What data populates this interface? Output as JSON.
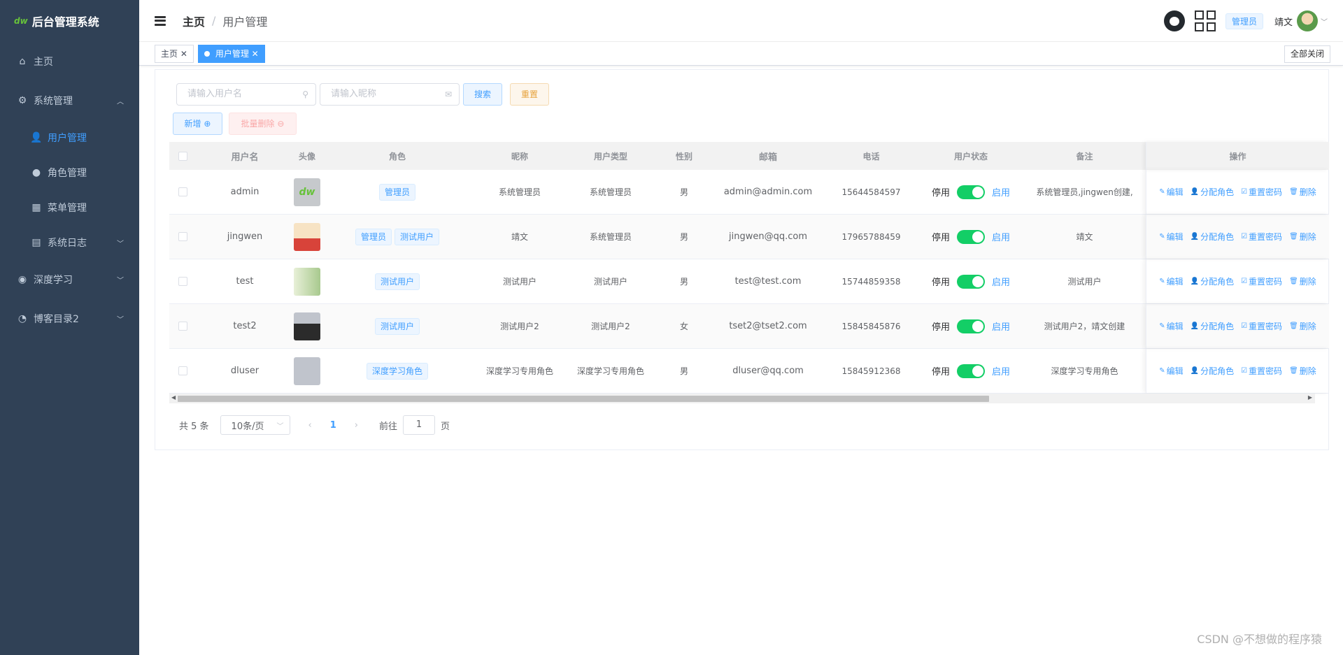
{
  "app": {
    "logo_mark": "dw",
    "title": "后台管理系统"
  },
  "sidebar": {
    "items": [
      {
        "label": "主页"
      },
      {
        "label": "系统管理"
      },
      {
        "label": "用户管理"
      },
      {
        "label": "角色管理"
      },
      {
        "label": "菜单管理"
      },
      {
        "label": "系统日志"
      },
      {
        "label": "深度学习"
      },
      {
        "label": "博客目录2"
      }
    ]
  },
  "header": {
    "breadcrumb": {
      "home": "主页",
      "sep": "/",
      "current": "用户管理"
    },
    "role": "管理员",
    "user": "靖文"
  },
  "tags": {
    "items": [
      {
        "label": "主页"
      },
      {
        "label": "用户管理"
      }
    ],
    "close_all": "全部关闭"
  },
  "search": {
    "username_placeholder": "请输入用户名",
    "nickname_placeholder": "请输入昵称",
    "search_label": "搜索",
    "reset_label": "重置",
    "add_label": "新增",
    "batch_delete_label": "批量删除"
  },
  "table": {
    "columns": [
      "用户名",
      "头像",
      "角色",
      "昵称",
      "用户类型",
      "性别",
      "邮箱",
      "电话",
      "用户状态",
      "备注",
      "操作"
    ],
    "status_off": "停用",
    "status_on": "启用",
    "actions": {
      "edit": "编辑",
      "assign": "分配角色",
      "reset_pwd": "重置密码",
      "delete": "删除"
    },
    "rows": [
      {
        "username": "admin",
        "avatar_text": "dw",
        "roles": [
          "管理员"
        ],
        "nickname": "系统管理员",
        "type": "系统管理员",
        "sex": "男",
        "email": "admin@admin.com",
        "phone": "15644584597",
        "status_enabled": true,
        "note": "系统管理员,jingwen创建,"
      },
      {
        "username": "jingwen",
        "roles": [
          "管理员",
          "测试用户"
        ],
        "nickname": "靖文",
        "type": "系统管理员",
        "sex": "男",
        "email": "jingwen@qq.com",
        "phone": "17965788459",
        "status_enabled": true,
        "note": "靖文"
      },
      {
        "username": "test",
        "roles": [
          "测试用户"
        ],
        "nickname": "测试用户",
        "type": "测试用户",
        "sex": "男",
        "email": "test@test.com",
        "phone": "15744859358",
        "status_enabled": true,
        "note": "测试用户"
      },
      {
        "username": "test2",
        "roles": [
          "测试用户"
        ],
        "nickname": "测试用户2",
        "type": "测试用户2",
        "sex": "女",
        "email": "tset2@tset2.com",
        "phone": "15845845876",
        "status_enabled": true,
        "note": "测试用户2，靖文创建"
      },
      {
        "username": "dluser",
        "roles": [
          "深度学习角色"
        ],
        "nickname": "深度学习专用角色",
        "type": "深度学习专用角色",
        "sex": "男",
        "email": "dluser@qq.com",
        "phone": "15845912368",
        "status_enabled": true,
        "note": "深度学习专用角色"
      }
    ]
  },
  "pagination": {
    "total": "共 5 条",
    "page_size": "10条/页",
    "prev": "‹",
    "current_page": "1",
    "next": "›",
    "goto": "前往",
    "goto_value": "1",
    "page_unit": "页"
  },
  "watermark": "CSDN @不想做的程序猿"
}
